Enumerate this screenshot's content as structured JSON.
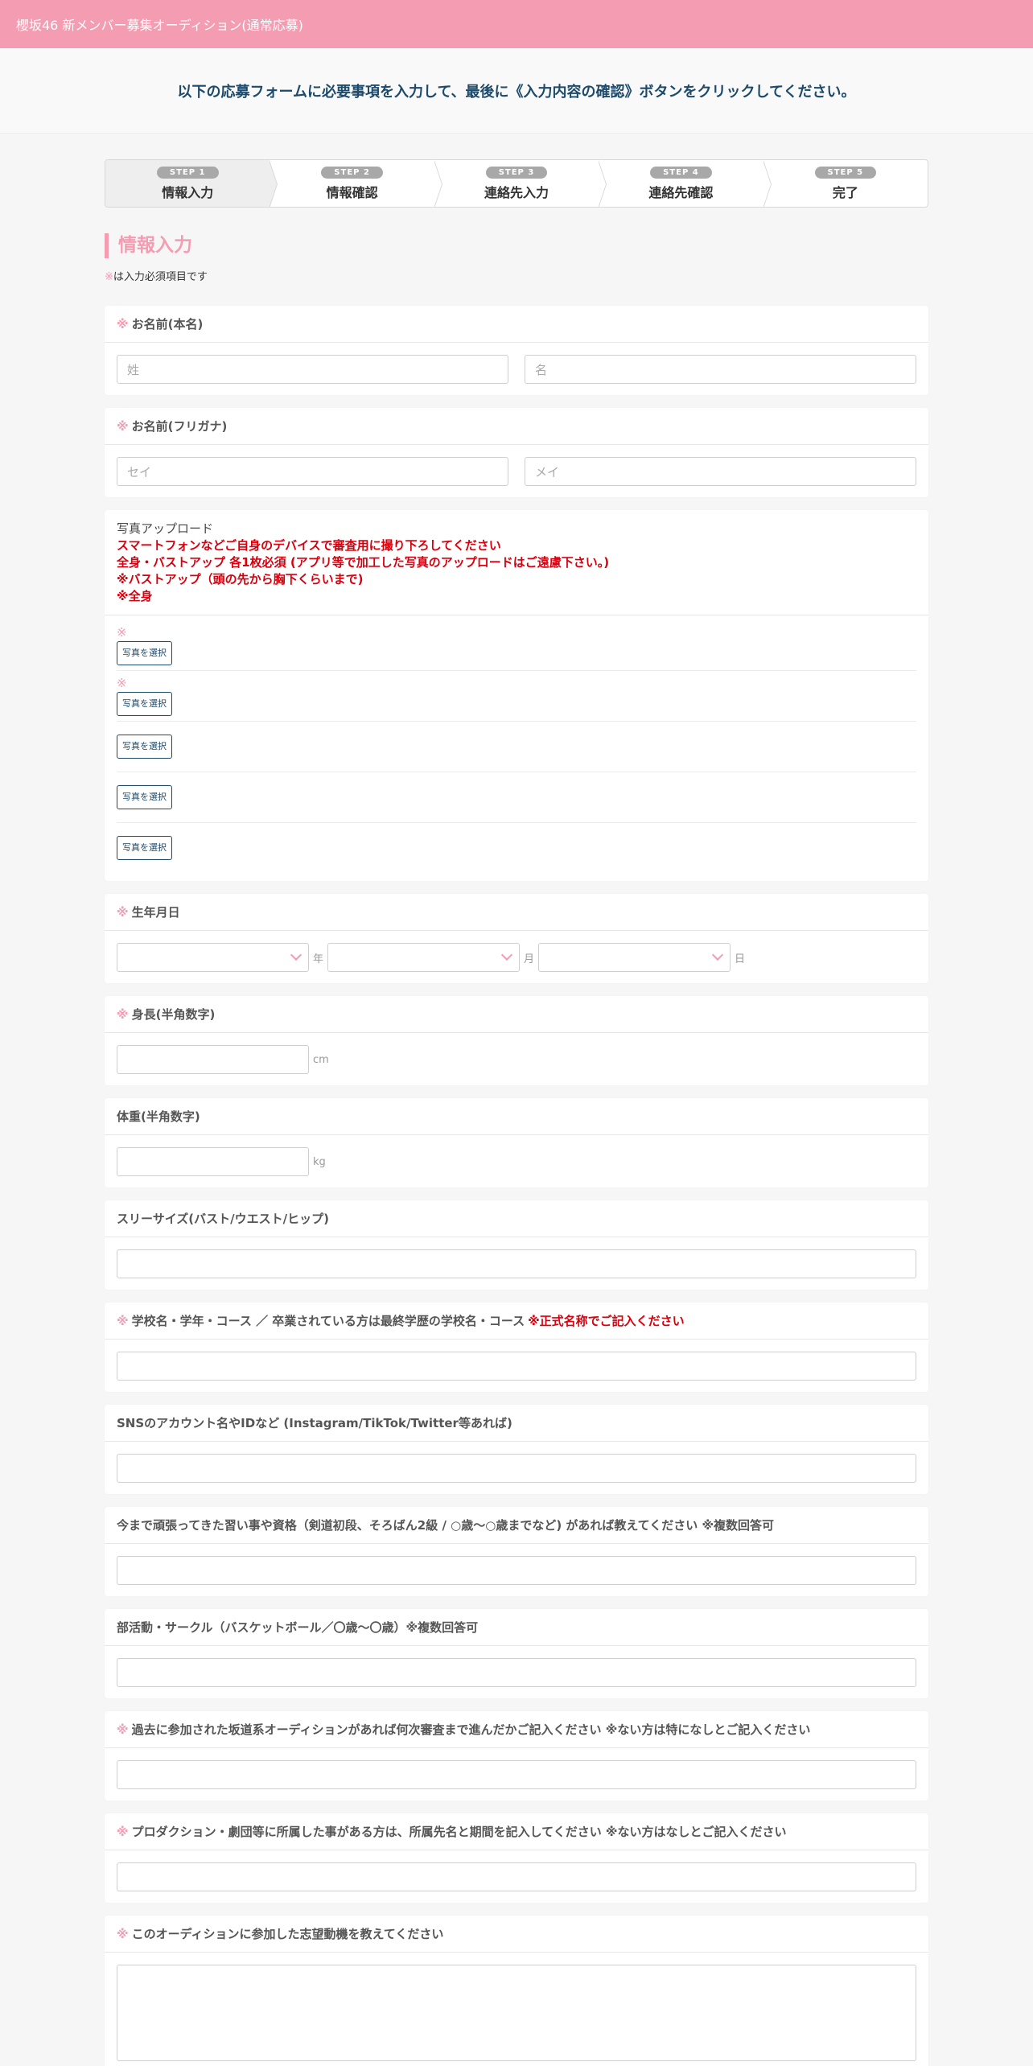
{
  "header": {
    "title": "櫻坂46 新メンバー募集オーディション(通常応募)"
  },
  "intro": {
    "text": "以下の応募フォームに必要事項を入力して、最後に《入力内容の確認》ボタンをクリックしてください。"
  },
  "steps": [
    {
      "badge": "STEP 1",
      "label": "情報入力"
    },
    {
      "badge": "STEP 2",
      "label": "情報確認"
    },
    {
      "badge": "STEP 3",
      "label": "連絡先入力"
    },
    {
      "badge": "STEP 4",
      "label": "連絡先確認"
    },
    {
      "badge": "STEP 5",
      "label": "完了"
    }
  ],
  "section": {
    "title": "情報入力",
    "required_mark": "※",
    "required_note": "は入力必須項目です"
  },
  "fields": {
    "name": {
      "mark": "※",
      "label": "お名前(本名)",
      "last_placeholder": "姓",
      "first_placeholder": "名"
    },
    "kana": {
      "mark": "※",
      "label": "お名前(フリガナ)",
      "last_placeholder": "セイ",
      "first_placeholder": "メイ"
    },
    "photo": {
      "title": "写真アップロード",
      "notes": [
        "スマートフォンなどご自身のデバイスで審査用に撮り下ろしてください",
        "全身・バストアップ 各1枚必須 (アプリ等で加工した写真のアップロードはご遠慮下さい。)",
        "※バストアップ（頭の先から胸下くらいまで)",
        "※全身"
      ],
      "rows": [
        {
          "mark": "※",
          "button": "写真を選択"
        },
        {
          "mark": "※",
          "button": "写真を選択"
        },
        {
          "mark": "",
          "button": "写真を選択"
        },
        {
          "mark": "",
          "button": "写真を選択"
        },
        {
          "mark": "",
          "button": "写真を選択"
        }
      ]
    },
    "birthday": {
      "mark": "※",
      "label": "生年月日",
      "year_unit": "年",
      "month_unit": "月",
      "day_unit": "日"
    },
    "height": {
      "mark": "※",
      "label": "身長(半角数字)",
      "unit": "cm"
    },
    "weight": {
      "label": "体重(半角数字)",
      "unit": "kg"
    },
    "sizes": {
      "label": "スリーサイズ(バスト/ウエスト/ヒップ)"
    },
    "school": {
      "mark": "※",
      "label": "学校名・学年・コース ／ 卒業されている方は最終学歴の学校名・コース",
      "note": "※正式名称でご記入ください"
    },
    "sns": {
      "label": "SNSのアカウント名やIDなど (Instagram/TikTok/Twitter等あれば)"
    },
    "lessons": {
      "label": "今まで頑張ってきた習い事や資格（剣道初段、そろばん2級 / ○歳～○歳までなど) があれば教えてください ※複数回答可"
    },
    "clubs": {
      "label": "部活動・サークル（バスケットボール／〇歳～〇歳）※複数回答可"
    },
    "past_auditions": {
      "mark": "※",
      "label": "過去に参加された坂道系オーディションがあれば何次審査まで進んだかご記入ください ※ない方は特になしとご記入ください"
    },
    "production": {
      "mark": "※",
      "label": "プロダクション・劇団等に所属した事がある方は、所属先名と期間を記入してください ※ない方はなしとご記入ください"
    },
    "motivation": {
      "mark": "※",
      "label": "このオーディションに参加した志望動機を教えてください"
    }
  }
}
